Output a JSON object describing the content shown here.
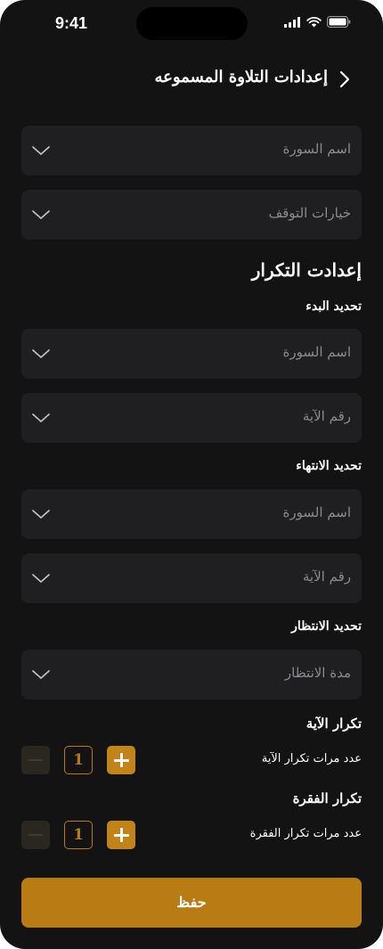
{
  "status_bar": {
    "time": "9:41"
  },
  "header": {
    "title": "إعدادات التلاوة المسموعه"
  },
  "top_fields": {
    "surah_placeholder": "اسم السورة",
    "stop_options_placeholder": "خيارات التوقف"
  },
  "repeat_settings": {
    "title": "إعدادت التكرار",
    "start": {
      "label": "تحديد البدء",
      "surah_placeholder": "اسم السورة",
      "ayah_placeholder": "رقم الآية"
    },
    "end": {
      "label": "تحديد الانتهاء",
      "surah_placeholder": "اسم السورة",
      "ayah_placeholder": "رقم الآية"
    },
    "wait": {
      "label": "تحديد الانتظار",
      "placeholder": "مدة الانتظار"
    },
    "ayah_repeat": {
      "title": "تكرار الآية",
      "label": "عدد مرات تكرار الآية",
      "value": "1"
    },
    "passage_repeat": {
      "title": "تكرار الفقرة",
      "label": "عدد مرات تكرار الفقرة",
      "value": "1"
    }
  },
  "save_label": "حفظ",
  "colors": {
    "background": "#131313",
    "field": "#1f1f21",
    "accent": "#b97c15",
    "placeholder": "#8b8b8f"
  }
}
